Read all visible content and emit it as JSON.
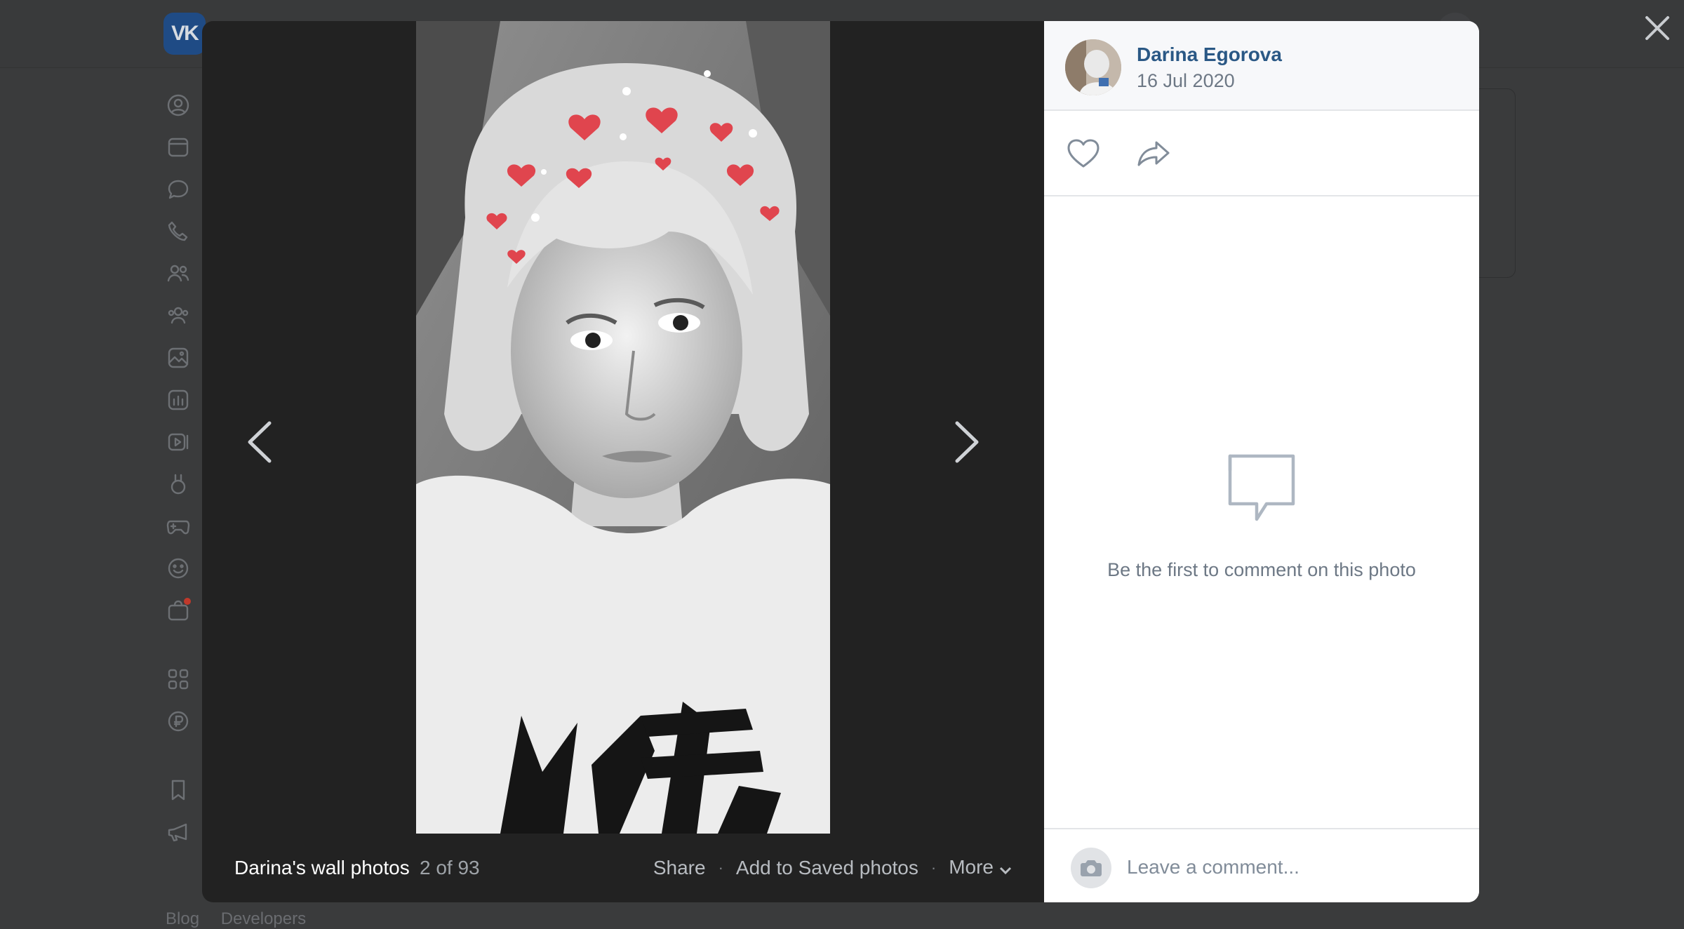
{
  "background": {
    "logo_text": "VK",
    "footer_links": [
      "Blog",
      "Developers"
    ]
  },
  "viewer": {
    "album_title": "Darina's wall photos",
    "counter": "2 of 93",
    "actions": {
      "share": "Share",
      "save": "Add to Saved photos",
      "more": "More"
    }
  },
  "post": {
    "author": "Darina Egorova",
    "date": "16 Jul 2020"
  },
  "comments": {
    "empty_text": "Be the first to comment on this photo",
    "placeholder": "Leave a comment..."
  },
  "colors": {
    "link": "#2a5885",
    "secondary_text": "#6d7885",
    "viewer_bg": "#222222",
    "overlay_bg": "#3a3b3c"
  }
}
